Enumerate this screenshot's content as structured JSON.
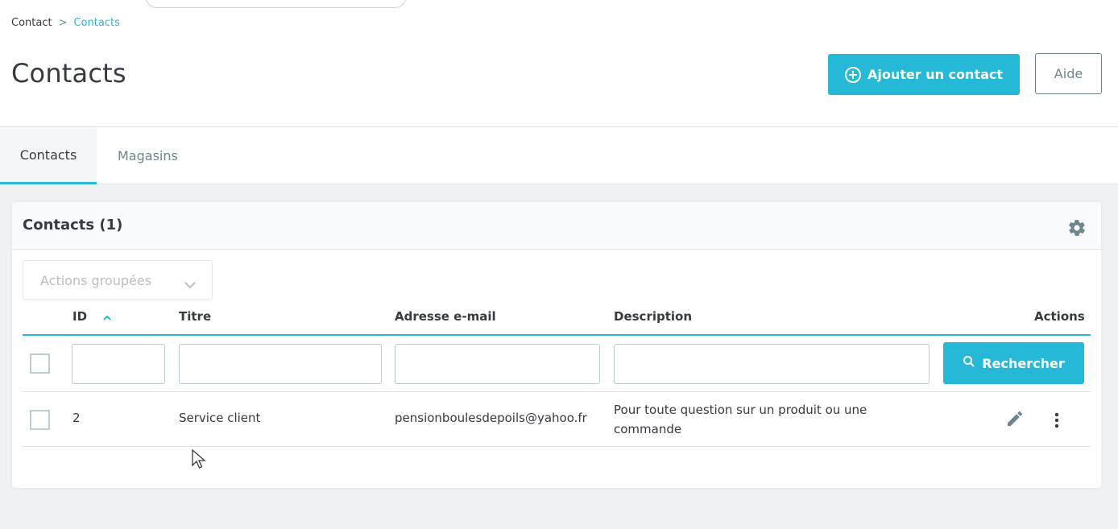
{
  "breadcrumb": {
    "parent": "Contact",
    "separator": ">",
    "current": "Contacts"
  },
  "page_title": "Contacts",
  "toolbar": {
    "add_label": "Ajouter un contact",
    "help_label": "Aide"
  },
  "tabs": [
    {
      "label": "Contacts",
      "active": true
    },
    {
      "label": "Magasins",
      "active": false
    }
  ],
  "card": {
    "title": "Contacts (1)",
    "bulk_actions_label": "Actions groupées"
  },
  "table": {
    "columns": {
      "id": "ID",
      "titre": "Titre",
      "email": "Adresse e-mail",
      "description": "Description",
      "actions": "Actions"
    },
    "filters": {
      "id": "",
      "titre": "",
      "email": "",
      "description": ""
    },
    "search_label": "Rechercher",
    "rows": [
      {
        "id": "2",
        "titre": "Service client",
        "email": "pensionboulesdepoils@yahoo.fr",
        "description": "Pour toute question sur un produit ou une commande"
      }
    ]
  },
  "colors": {
    "accent": "#25b9d7",
    "text": "#363a41",
    "muted": "#6c868e",
    "background": "#eff1f2"
  },
  "icons": {
    "add": "plus-circle-icon",
    "settings": "gear-icon",
    "dropdown": "chevron-down-icon",
    "sort": "sort-asc-icon",
    "search": "search-icon",
    "edit": "pencil-icon",
    "more": "more-vertical-icon"
  }
}
